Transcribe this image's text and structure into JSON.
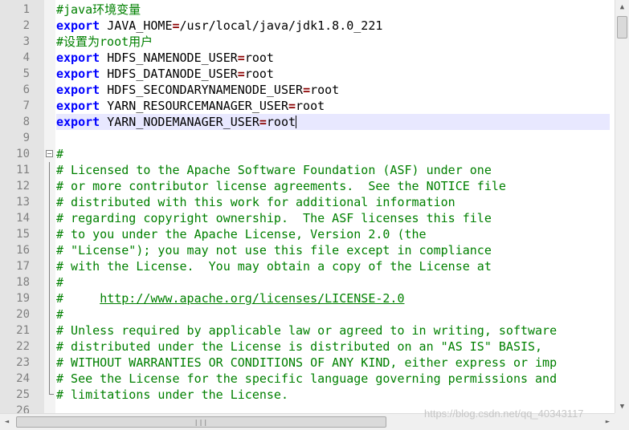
{
  "editor": {
    "lines": [
      {
        "n": "1",
        "segments": [
          {
            "t": "#java环境变量",
            "c": "cm"
          }
        ]
      },
      {
        "n": "2",
        "segments": [
          {
            "t": "export",
            "c": "kw"
          },
          {
            "t": " JAVA_HOME",
            "c": ""
          },
          {
            "t": "=",
            "c": "op"
          },
          {
            "t": "/usr/local/java/jdk1.8.0_221",
            "c": ""
          }
        ]
      },
      {
        "n": "3",
        "segments": [
          {
            "t": "#设置为root用户",
            "c": "cm"
          }
        ]
      },
      {
        "n": "4",
        "segments": [
          {
            "t": "export",
            "c": "kw"
          },
          {
            "t": " HDFS_NAMENODE_USER",
            "c": ""
          },
          {
            "t": "=",
            "c": "op"
          },
          {
            "t": "root",
            "c": ""
          }
        ]
      },
      {
        "n": "5",
        "segments": [
          {
            "t": "export",
            "c": "kw"
          },
          {
            "t": " HDFS_DATANODE_USER",
            "c": ""
          },
          {
            "t": "=",
            "c": "op"
          },
          {
            "t": "root",
            "c": ""
          }
        ]
      },
      {
        "n": "6",
        "segments": [
          {
            "t": "export",
            "c": "kw"
          },
          {
            "t": " HDFS_SECONDARYNAMENODE_USER",
            "c": ""
          },
          {
            "t": "=",
            "c": "op"
          },
          {
            "t": "root",
            "c": ""
          }
        ]
      },
      {
        "n": "7",
        "segments": [
          {
            "t": "export",
            "c": "kw"
          },
          {
            "t": " YARN_RESOURCEMANAGER_USER",
            "c": ""
          },
          {
            "t": "=",
            "c": "op"
          },
          {
            "t": "root",
            "c": ""
          }
        ]
      },
      {
        "n": "8",
        "current": true,
        "caret": true,
        "segments": [
          {
            "t": "export",
            "c": "kw"
          },
          {
            "t": " YARN_NODEMANAGER_USER",
            "c": ""
          },
          {
            "t": "=",
            "c": "op"
          },
          {
            "t": "root",
            "c": ""
          }
        ]
      },
      {
        "n": "9",
        "segments": []
      },
      {
        "n": "10",
        "fold": "start",
        "segments": [
          {
            "t": "#",
            "c": "cm"
          }
        ]
      },
      {
        "n": "11",
        "fold": "line",
        "segments": [
          {
            "t": "# Licensed to the Apache Software Foundation (ASF) under one",
            "c": "cm"
          }
        ]
      },
      {
        "n": "12",
        "fold": "line",
        "segments": [
          {
            "t": "# or more contributor license agreements.  See the NOTICE file",
            "c": "cm"
          }
        ]
      },
      {
        "n": "13",
        "fold": "line",
        "segments": [
          {
            "t": "# distributed with this work for additional information",
            "c": "cm"
          }
        ]
      },
      {
        "n": "14",
        "fold": "line",
        "segments": [
          {
            "t": "# regarding copyright ownership.  The ASF licenses this file",
            "c": "cm"
          }
        ]
      },
      {
        "n": "15",
        "fold": "line",
        "segments": [
          {
            "t": "# to you under the Apache License, Version 2.0 (the",
            "c": "cm"
          }
        ]
      },
      {
        "n": "16",
        "fold": "line",
        "segments": [
          {
            "t": "# \"License\"); you may not use this file except in compliance",
            "c": "cm"
          }
        ]
      },
      {
        "n": "17",
        "fold": "line",
        "segments": [
          {
            "t": "# with the License.  You may obtain a copy of the License at",
            "c": "cm"
          }
        ]
      },
      {
        "n": "18",
        "fold": "line",
        "segments": [
          {
            "t": "#",
            "c": "cm"
          }
        ]
      },
      {
        "n": "19",
        "fold": "line",
        "segments": [
          {
            "t": "#     ",
            "c": "cm"
          },
          {
            "t": "http://www.apache.org/licenses/LICENSE-2.0",
            "c": "link"
          }
        ]
      },
      {
        "n": "20",
        "fold": "line",
        "segments": [
          {
            "t": "#",
            "c": "cm"
          }
        ]
      },
      {
        "n": "21",
        "fold": "line",
        "segments": [
          {
            "t": "# Unless required by applicable law or agreed to in writing, software",
            "c": "cm"
          }
        ]
      },
      {
        "n": "22",
        "fold": "line",
        "segments": [
          {
            "t": "# distributed under the License is distributed on an \"AS IS\" BASIS,",
            "c": "cm"
          }
        ]
      },
      {
        "n": "23",
        "fold": "line",
        "segments": [
          {
            "t": "# WITHOUT WARRANTIES OR CONDITIONS OF ANY KIND, either express or imp",
            "c": "cm"
          }
        ]
      },
      {
        "n": "24",
        "fold": "line",
        "segments": [
          {
            "t": "# See the License for the specific language governing permissions and",
            "c": "cm"
          }
        ]
      },
      {
        "n": "25",
        "fold": "end",
        "segments": [
          {
            "t": "# limitations under the License.",
            "c": "cm"
          }
        ]
      },
      {
        "n": "26",
        "segments": []
      }
    ]
  },
  "scrollbar": {
    "up_icon": "▲",
    "down_icon": "▼",
    "left_icon": "◄",
    "right_icon": "►",
    "grip": "|||"
  },
  "watermark": "https://blog.csdn.net/qq_40343117"
}
